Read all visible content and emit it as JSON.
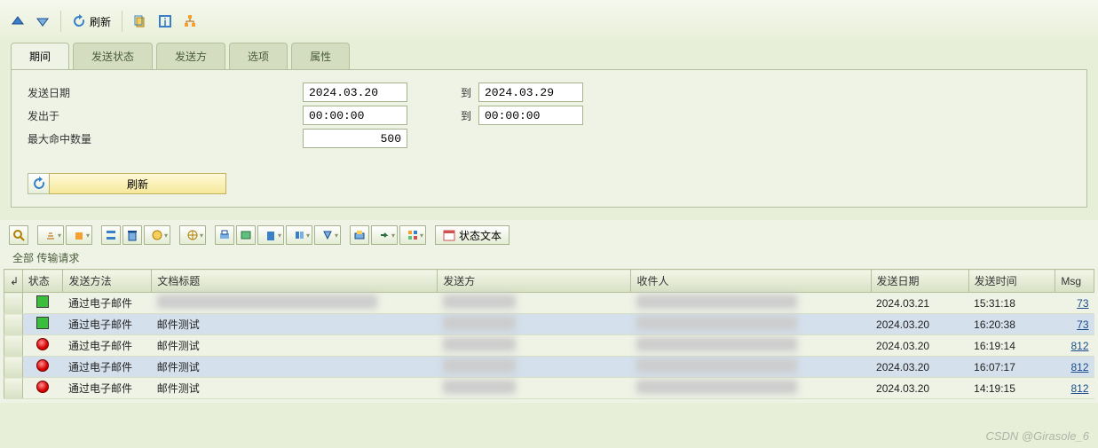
{
  "toolbar": {
    "refresh_label": "刷新"
  },
  "tabs": [
    "期间",
    "发送状态",
    "发送方",
    "选项",
    "属性"
  ],
  "active_tab": 0,
  "form": {
    "send_date_label": "发送日期",
    "sent_at_label": "发出于",
    "max_hits_label": "最大命中数量",
    "to_label": "到",
    "date_from": "2024.03.20",
    "date_to": "2024.03.29",
    "time_from": "00:00:00",
    "time_to": "00:00:00",
    "max_hits": "500",
    "refresh_btn": "刷新"
  },
  "grid_toolbar": {
    "status_text_btn": "状态文本"
  },
  "crumb": "全部  传输请求",
  "columns": {
    "status": "状态",
    "method": "发送方法",
    "title": "文档标题",
    "sender": "发送方",
    "recipient": "收件人",
    "date": "发送日期",
    "time": "发送时间",
    "msg": "Msg"
  },
  "rows": [
    {
      "status": "green",
      "method": "通过电子邮件",
      "title": "",
      "date": "2024.03.21",
      "time": "15:31:18",
      "msg": "73",
      "zebra": false,
      "title_blur": true
    },
    {
      "status": "green",
      "method": "通过电子邮件",
      "title": "邮件测试",
      "date": "2024.03.20",
      "time": "16:20:38",
      "msg": "73",
      "zebra": true
    },
    {
      "status": "red",
      "method": "通过电子邮件",
      "title": "邮件测试",
      "date": "2024.03.20",
      "time": "16:19:14",
      "msg": "812",
      "zebra": false
    },
    {
      "status": "red",
      "method": "通过电子邮件",
      "title": "邮件测试",
      "date": "2024.03.20",
      "time": "16:07:17",
      "msg": "812",
      "zebra": true
    },
    {
      "status": "red",
      "method": "通过电子邮件",
      "title": "邮件测试",
      "date": "2024.03.20",
      "time": "14:19:15",
      "msg": "812",
      "zebra": false
    }
  ],
  "watermark": "CSDN @Girasole_6"
}
